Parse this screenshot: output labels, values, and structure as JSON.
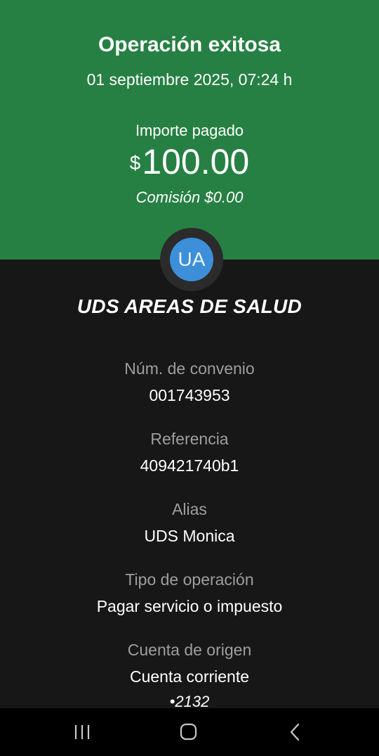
{
  "header": {
    "title": "Operación exitosa",
    "datetime": "01 septiembre 2025, 07:24 h",
    "amount_label": "Importe pagado",
    "currency_symbol": "$",
    "amount": "100.00",
    "fee": "Comisión  $0.00",
    "background_color": "#268043"
  },
  "merchant": {
    "initials": "UA",
    "name": "UDS AREAS DE SALUD",
    "avatar_color": "#3c8fd8"
  },
  "details": [
    {
      "label": "Núm. de convenio",
      "value": "001743953"
    },
    {
      "label": "Referencia",
      "value": "409421740b1"
    },
    {
      "label": "Alias",
      "value": "UDS Monica"
    },
    {
      "label": "Tipo de operación",
      "value": "Pagar servicio o impuesto"
    },
    {
      "label": "Cuenta de origen",
      "value": "Cuenta corriente",
      "value2": "•2132"
    }
  ],
  "navbar": {
    "recents_icon": "recents-icon",
    "home_icon": "home-icon",
    "back_icon": "back-icon"
  }
}
